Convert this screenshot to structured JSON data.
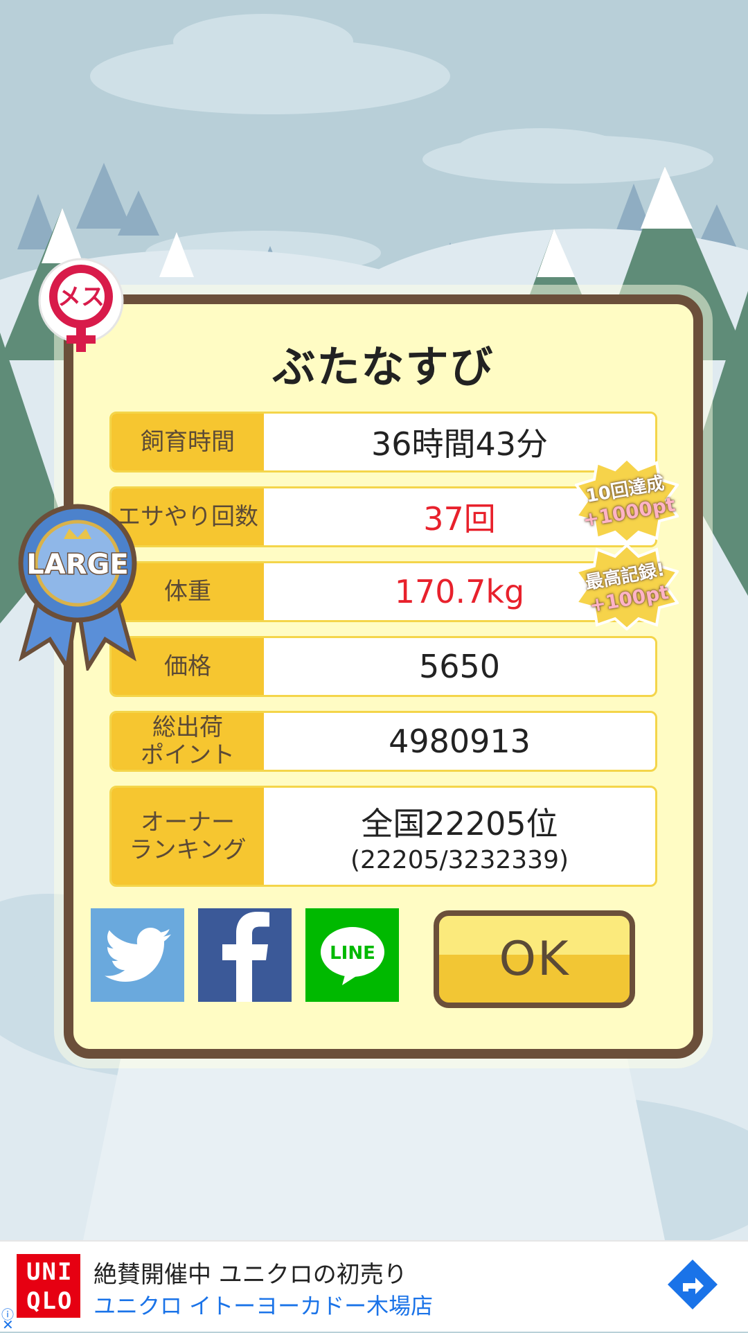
{
  "pig_name": "ぶたなすび",
  "gender_badge": "メス",
  "size_ribbon": "LARGE",
  "stats": [
    {
      "label": "飼育時間",
      "value": "36時間43分",
      "highlight": false
    },
    {
      "label": "エサやり回数",
      "value": "37回",
      "highlight": true
    },
    {
      "label": "体重",
      "value": "170.7kg",
      "highlight": true
    },
    {
      "label": "価格",
      "value": "5650",
      "highlight": false
    },
    {
      "label_line1": "総出荷",
      "label_line2": "ポイント",
      "value": "4980913",
      "highlight": false
    },
    {
      "label_line1": "オーナー",
      "label_line2": "ランキング",
      "value": "全国22205位",
      "subvalue": "(22205/3232339)",
      "highlight": false
    }
  ],
  "bonus_badges": [
    {
      "line1": "10回達成",
      "line2": "+1000pt"
    },
    {
      "line1": "最高記録!",
      "line2": "+100pt"
    }
  ],
  "share": {
    "line_label": "LINE"
  },
  "ok_label": "OK",
  "ad": {
    "brand_top": "UNI",
    "brand_bottom": "QLO",
    "headline": "絶賛開催中 ユニクロの初売り",
    "subline": "ユニクロ イトーヨーカドー木場店"
  },
  "colors": {
    "panel_bg": "#fffcc4",
    "panel_border": "#6b4f3a",
    "label_bg": "#f6c630",
    "highlight_red": "#e8212c",
    "twitter": "#6aa9dd",
    "facebook": "#3b5998",
    "line": "#00b900",
    "uniqlo_red": "#e60012",
    "ad_link": "#1a73e8"
  }
}
